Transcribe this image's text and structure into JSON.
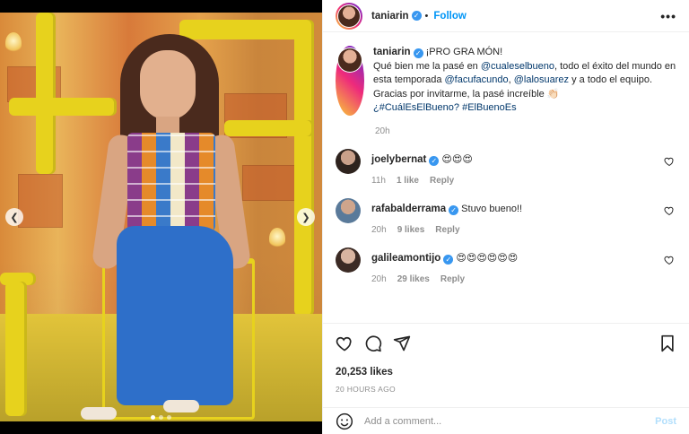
{
  "post": {
    "author": "taniarin",
    "follow_label": "Follow",
    "more_icon": "more-options-icon",
    "caption": {
      "greeting": "¡PRO GRA MÓN!",
      "text_1": "Qué bien me la pasé en ",
      "mention_1": "@cualeselbueno",
      "text_2": ", todo el éxito del mundo en esta temporada ",
      "mention_2": "@facufacundo",
      "text_3": ", ",
      "mention_3": "@lalosuarez",
      "text_4": " y a todo el equipo. Gracias por invitarme, la pasé increíble 👏🏻",
      "hashtag_1": "¿#CuálEsElBueno?",
      "hashtag_2": "#ElBuenoEs"
    },
    "caption_time": "20h",
    "likes": "20,253 likes",
    "posted": "20 HOURS AGO"
  },
  "comments": [
    {
      "user": "joelybernat",
      "text": "😍😍😍",
      "time": "11h",
      "likes": "1 like",
      "reply": "Reply"
    },
    {
      "user": "rafabalderrama",
      "text": "Stuvo bueno!!",
      "time": "20h",
      "likes": "9 likes",
      "reply": "Reply"
    },
    {
      "user": "galileamontijo",
      "text": "😍😍😍😍😍😍",
      "time": "20h",
      "likes": "29 likes",
      "reply": "Reply"
    }
  ],
  "composer": {
    "placeholder": "Add a comment...",
    "post_label": "Post"
  },
  "carousel": {
    "prev_icon": "chevron-left-icon",
    "next_icon": "chevron-right-icon",
    "slides": 3,
    "active": 1
  },
  "colors": {
    "accent": "#0095f6",
    "verified": "#3897f0",
    "text": "#262626",
    "muted": "#8e8e8e"
  }
}
